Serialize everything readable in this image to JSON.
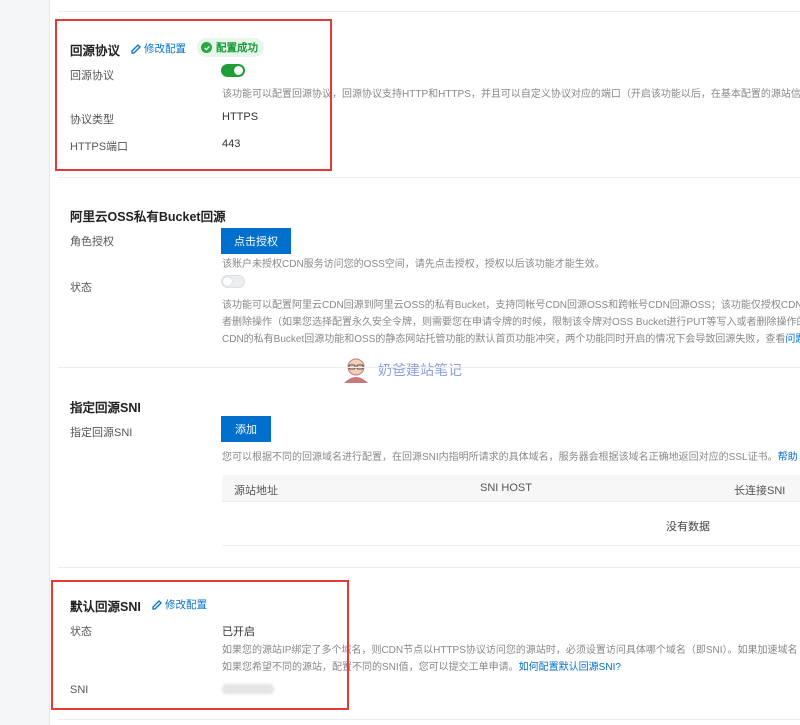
{
  "section1": {
    "title": "回源协议",
    "edit_label": "修改配置",
    "badge": "配置成功",
    "protocol_label": "回源协议",
    "protocol_desc": "该功能可以配置回源协议，回源协议支持HTTP和HTTPS，并且可以自定义协议对应的端口（开启该功能以后，在基本配置的源站信",
    "type_label": "协议类型",
    "type_value": "HTTPS",
    "port_label": "HTTPS端口",
    "port_value": "443"
  },
  "section2": {
    "title": "阿里云OSS私有Bucket回源",
    "auth_label": "角色授权",
    "auth_button": "点击授权",
    "auth_desc": "该账户未授权CDN服务访问您的OSS空间，请先点击授权，授权以后该功能才能生效。",
    "status_label": "状态",
    "desc_line1": "该功能可以配置阿里云CDN回源到阿里云OSS的私有Bucket，支持同帐号CDN回源OSS和跨帐号CDN回源OSS；该功能仅授权CDN对",
    "desc_line2": "者删除操作（如果您选择配置永久安全令牌，则需要您在申请令牌的时候，限制该令牌对OSS Bucket进行PUT等写入或者删除操作的",
    "desc_line3": "CDN的私有Bucket回源功能和OSS的静态网站托管功能的默认首页功能冲突，两个功能同时开启的情况下会导致回源失败，查看",
    "desc_link": "问题"
  },
  "watermark": "奶爸建站笔记",
  "section3": {
    "title": "指定回源SNI",
    "sni_label": "指定回源SNI",
    "add_button": "添加",
    "desc": "您可以根据不同的回源域名进行配置，在回源SNI内指明所请求的具体域名，服务器会根据该域名正确地返回对应的SSL证书。",
    "help_link": "帮助",
    "columns": [
      "源站地址",
      "SNI HOST",
      "长连接SNI"
    ],
    "empty_text": "没有数据"
  },
  "section4": {
    "title": "默认回源SNI",
    "edit_label": "修改配置",
    "status_label": "状态",
    "status_value": "已开启",
    "desc_line1": "如果您的源站IP绑定了多个域名，则CDN节点以HTTPS协议访问您的源站时，必须设置访问具体哪个域名（即SNI）。如果加速域名",
    "desc_line2": "如果您希望不同的源站，配置不同的SNI值，您可以提交工单申请。",
    "desc_link": "如何配置默认回源SNI?",
    "sni_label": "SNI"
  },
  "colors": {
    "accent": "#0070cc",
    "success": "#1e9e37",
    "highlight": "#e53935"
  }
}
